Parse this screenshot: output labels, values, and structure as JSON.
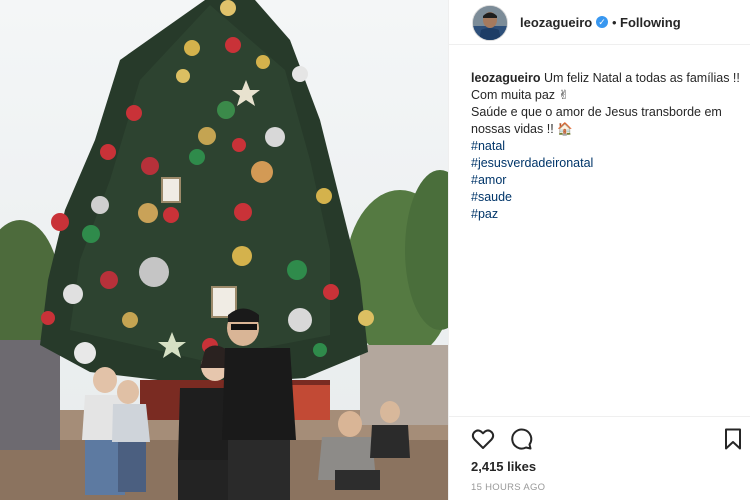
{
  "post": {
    "username": "leozagueiro",
    "verified_icon": "verified-badge-icon",
    "separator": "•",
    "follow_status": "Following",
    "caption_username": "leozagueiro",
    "caption_line1": "Um feliz Natal a todas as famílias !! Com muita paz ✌",
    "caption_line2": "Saúde e que o amor de Jesus transborde em nossas vidas !! 🏠",
    "hashtags": [
      "#natal",
      "#jesusverdadeironatal",
      "#amor",
      "#saude",
      "#paz"
    ],
    "likes": "2,415 likes",
    "timestamp": "15 HOURS AGO"
  },
  "icons": {
    "like": "heart-icon",
    "comment": "comment-icon",
    "save": "bookmark-icon"
  },
  "colors": {
    "link": "#003569",
    "verified": "#3897f0",
    "timestamp": "#999999",
    "text": "#262626"
  }
}
